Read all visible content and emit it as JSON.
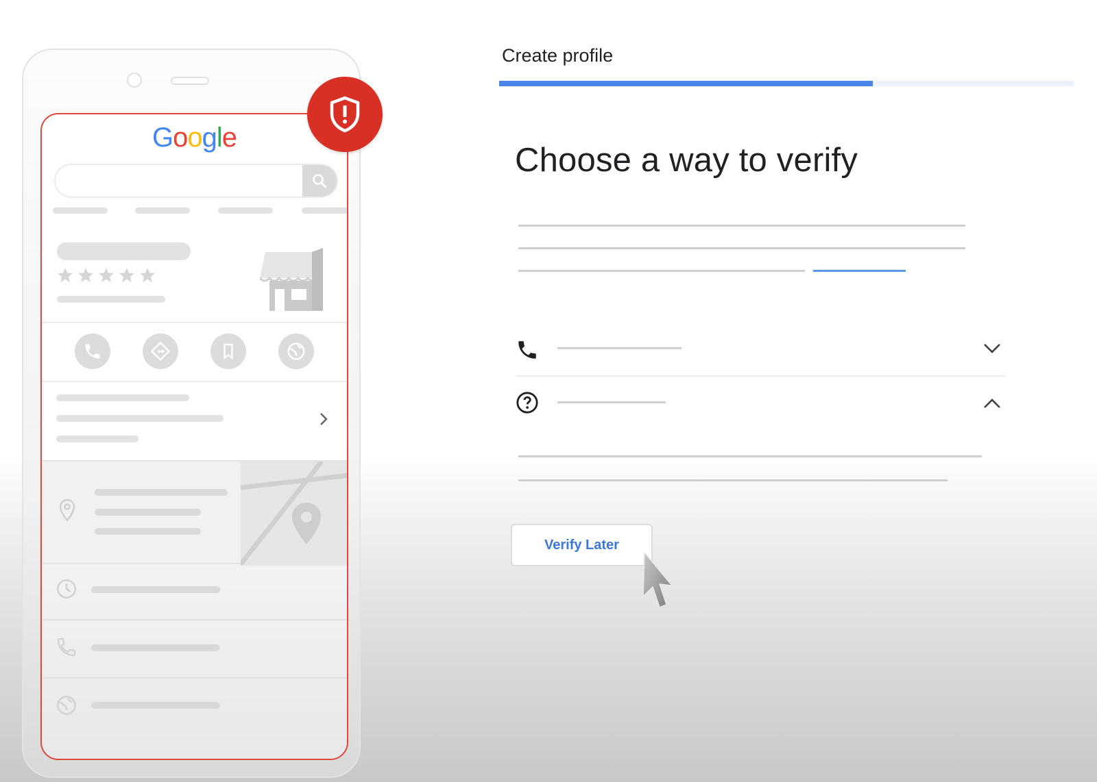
{
  "phone_mockup": {
    "search_engine_logo": {
      "letters": [
        "G",
        "o",
        "o",
        "g",
        "l",
        "e"
      ],
      "colors": [
        "#4285f4",
        "#ea4335",
        "#fbbc05",
        "#4285f4",
        "#34a853",
        "#ea4335"
      ]
    },
    "rating_stars": 5,
    "action_icons": [
      "phone-icon",
      "directions-icon",
      "bookmark-icon",
      "globe-icon"
    ],
    "detail_icons": [
      "location-pin-icon",
      "clock-icon",
      "phone-icon",
      "globe-icon"
    ],
    "badge_icon": "shield-alert-icon",
    "badge_color": "#d93025",
    "screen_border_color": "#e0483d"
  },
  "panel": {
    "step_label": "Create profile",
    "progress": 0.65,
    "progress_color": "#4a86e8",
    "heading": "Choose a way to verify",
    "options": [
      {
        "icon": "phone-icon",
        "state": "collapsed",
        "chevron": "chevron-down-icon"
      },
      {
        "icon": "help-circle-icon",
        "state": "expanded",
        "chevron": "chevron-up-icon"
      }
    ],
    "verify_later_label": "Verify Later",
    "link_color": "#3b78d8"
  }
}
